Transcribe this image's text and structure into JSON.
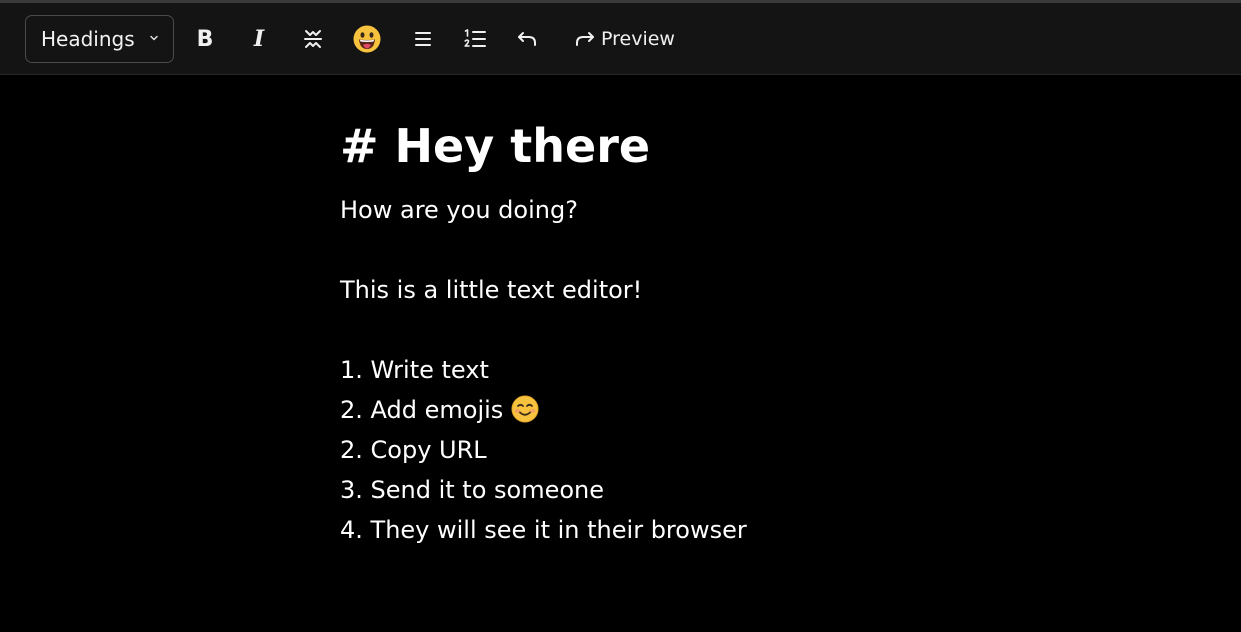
{
  "toolbar": {
    "headings_label": "Headings",
    "bold_label": "B",
    "italic_label": "I",
    "preview_label": "Preview",
    "icons": {
      "chevron": "chevron-down-icon",
      "strike": "strikethrough-icon",
      "emoji": "grinning-face-icon",
      "bullet_list": "bullet-list-icon",
      "numbered_list": "numbered-list-icon",
      "undo": "undo-icon",
      "redo": "redo-icon"
    }
  },
  "editor": {
    "heading": "# Hey there",
    "paragraph1": "How are you doing?",
    "paragraph2": "This is a little text editor!",
    "list": [
      "1. Write text",
      "2. Add emojis",
      "2. Copy URL",
      "3. Send it to someone",
      "4. They will see it in their browser"
    ],
    "inline_emoji": "smiling-face-icon"
  },
  "colors": {
    "background": "#000000",
    "toolbar": "#141414",
    "text": "#ffffff",
    "emoji_yellow": "#f7c23e"
  }
}
